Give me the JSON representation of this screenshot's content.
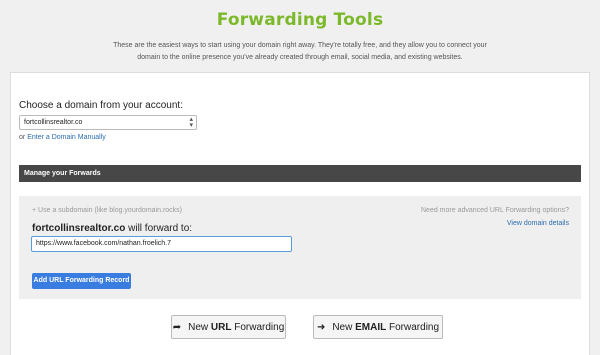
{
  "header": {
    "title": "Forwarding Tools",
    "intro_line1": "These are the easiest ways to start using your domain right away. They're totally free, and they allow you to connect your",
    "intro_line2": "domain to the online presence you've already created through email, social media, and existing websites."
  },
  "domain_chooser": {
    "label": "Choose a domain from your account:",
    "selected": "fortcollinsrealtor.co",
    "or_text": "or",
    "manual_link": "Enter a Domain Manually"
  },
  "manage": {
    "bar_label": "Manage your Forwards",
    "subdomain_hint": "Use a subdomain (like blog.yourdomain.rocks)",
    "advanced_text": "Need more advanced URL Forwarding options?",
    "view_details": "View domain details",
    "domain_bold": "fortcollinsrealtor.co",
    "will_forward": "will forward to:",
    "url_value": "https://www.facebook.com/nathan.froelich.7",
    "add_button": "Add URL Forwarding Record"
  },
  "bottom_buttons": {
    "new_url_prefix": "New",
    "new_url_bold": "URL",
    "new_url_suffix": "Forwarding",
    "new_email_prefix": "New",
    "new_email_bold": "EMAIL",
    "new_email_suffix": "Forwarding"
  },
  "icons": {
    "plus": "plus-icon",
    "chevron": "chevron-updown-icon",
    "share_arrow": "share-arrow-icon",
    "right_arrow": "arrow-right-icon"
  },
  "colors": {
    "title_green": "#7cb92a",
    "bar_dark": "#474747",
    "button_blue": "#3a7de0",
    "link_blue": "#2b6cb0"
  }
}
